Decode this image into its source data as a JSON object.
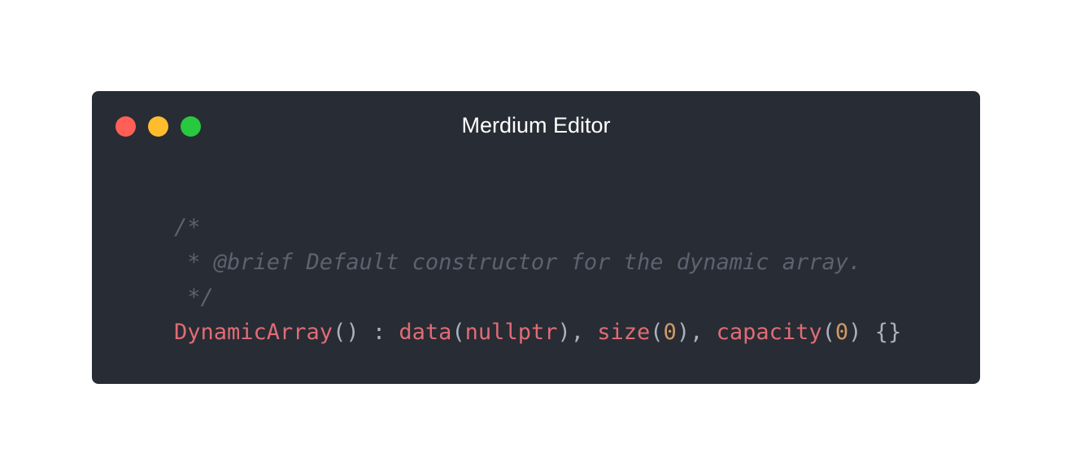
{
  "window": {
    "title": "Merdium Editor",
    "controls": {
      "close_color": "#ff5f56",
      "minimize_color": "#ffbd2e",
      "maximize_color": "#27c93f"
    },
    "background": "#282c34"
  },
  "code": {
    "language": "cpp",
    "comment_lines": [
      "/*",
      " * @brief Default constructor for the dynamic array.",
      " */"
    ],
    "constructor": {
      "name": "DynamicArray",
      "parens": "()",
      "colon": " : ",
      "init1_name": "data",
      "init1_open": "(",
      "init1_value": "nullptr",
      "init1_close": "), ",
      "init2_name": "size",
      "init2_open": "(",
      "init2_value": "0",
      "init2_close": "), ",
      "init3_name": "capacity",
      "init3_open": "(",
      "init3_value": "0",
      "init3_close": ") ",
      "body": "{}"
    },
    "colors": {
      "comment": "#5c6370",
      "identifier": "#e06c75",
      "number": "#d19a66",
      "punctuation": "#abb2bf"
    }
  }
}
